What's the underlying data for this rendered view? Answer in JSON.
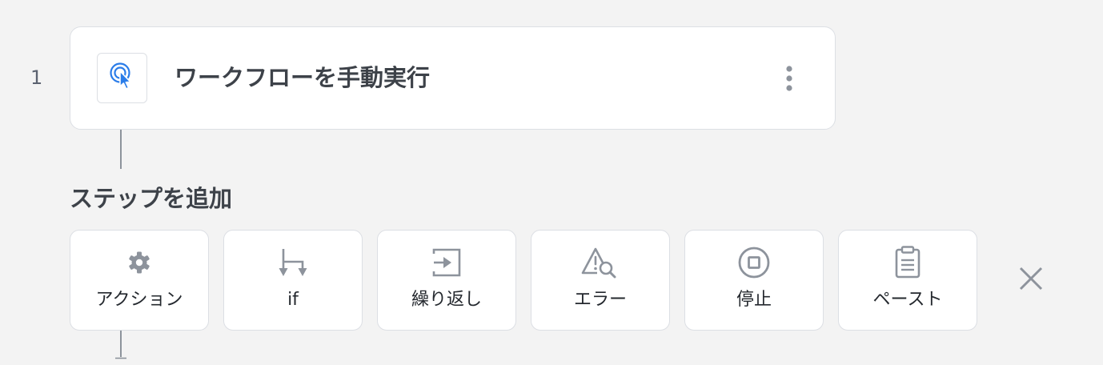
{
  "workflow": {
    "step_number": "1",
    "trigger": {
      "title": "ワークフローを手動実行",
      "icon": "tap-pointer-icon",
      "menu_icon": "kebab-menu-icon"
    }
  },
  "add_step": {
    "title": "ステップを追加",
    "options": [
      {
        "id": "action",
        "label": "アクション",
        "icon": "gear-icon"
      },
      {
        "id": "if",
        "label": "if",
        "icon": "branch-icon"
      },
      {
        "id": "loop",
        "label": "繰り返し",
        "icon": "loop-icon"
      },
      {
        "id": "error",
        "label": "エラー",
        "icon": "error-search-icon"
      },
      {
        "id": "stop",
        "label": "停止",
        "icon": "stop-icon"
      },
      {
        "id": "paste",
        "label": "ペースト",
        "icon": "clipboard-icon"
      }
    ],
    "close_icon": "close-icon"
  },
  "colors": {
    "background": "#f3f3f3",
    "card": "#ffffff",
    "border": "#dcdfe4",
    "icon_gray": "#8d939c",
    "accent_blue": "#2b7de9",
    "text_dark": "#3d4249"
  }
}
